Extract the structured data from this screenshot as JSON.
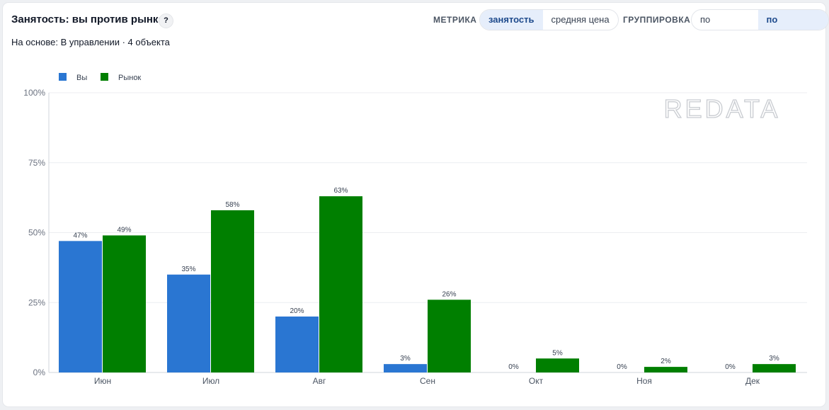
{
  "header": {
    "title": "Занятость: вы против рынка",
    "help": "?",
    "subtitle": "На основе: В управлении · 4 объекта"
  },
  "controls": {
    "metric_label": "МЕТРИКА",
    "metric_options": [
      "занятость",
      "средняя цена"
    ],
    "metric_selected": "занятость",
    "grouping_label": "ГРУППИРОВКА",
    "grouping_options": [
      "по неделям",
      "по месяцам"
    ],
    "grouping_selected": "по месяцам"
  },
  "watermark": "REDATA",
  "chart_data": {
    "type": "bar",
    "categories": [
      "Июн",
      "Июл",
      "Авг",
      "Сен",
      "Окт",
      "Ноя",
      "Дек"
    ],
    "series": [
      {
        "name": "Вы",
        "values": [
          47,
          35,
          20,
          3,
          0,
          0,
          0
        ],
        "labels": [
          "47%",
          "35%",
          "20%",
          "3%",
          "0%",
          "0%",
          "0%"
        ],
        "color": "#2a76d2"
      },
      {
        "name": "Рынок",
        "values": [
          49,
          58,
          63,
          26,
          5,
          2,
          3
        ],
        "labels": [
          "49%",
          "58%",
          "63%",
          "26%",
          "5%",
          "2%",
          "3%"
        ],
        "color": "#007f00"
      }
    ],
    "ylim": [
      0,
      100
    ],
    "yticks": [
      0,
      25,
      50,
      75,
      100
    ],
    "ytick_labels": [
      "0%",
      "25%",
      "50%",
      "75%",
      "100%"
    ],
    "grid": true,
    "legend": "top-left"
  }
}
